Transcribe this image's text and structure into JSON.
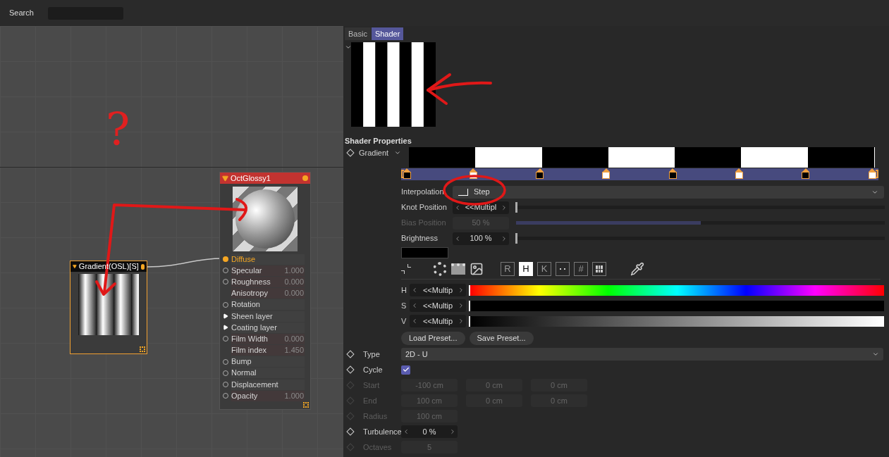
{
  "search": {
    "label": "Search"
  },
  "annotation": {
    "question": "?"
  },
  "nodes": [
    {
      "kind": "material",
      "title": "OctGlossy1",
      "selected": false,
      "ports": [
        {
          "kind": "port",
          "label": "Diffuse",
          "connected": true
        },
        {
          "kind": "port",
          "label": "Specular",
          "value": "1.000",
          "connected": false
        },
        {
          "kind": "port",
          "label": "Roughness",
          "value": "0.000",
          "connected": false
        },
        {
          "kind": "none",
          "label": "Anisotropy",
          "value": "0.000"
        },
        {
          "kind": "port",
          "label": "Rotation",
          "connected": false
        },
        {
          "kind": "group",
          "label": "Sheen layer"
        },
        {
          "kind": "group",
          "label": "Coating layer"
        },
        {
          "kind": "port",
          "label": "Film Width",
          "value": "0.000",
          "connected": false
        },
        {
          "kind": "none",
          "label": "Film index",
          "value": "1.450"
        },
        {
          "kind": "port",
          "label": "Bump",
          "connected": false
        },
        {
          "kind": "port",
          "label": "Normal",
          "connected": false
        },
        {
          "kind": "port",
          "label": "Displacement",
          "connected": false
        },
        {
          "kind": "port",
          "label": "Opacity",
          "value": "1.000",
          "connected": false
        }
      ]
    },
    {
      "kind": "texture",
      "title": "Gradient(OSL)[S]",
      "selected": true
    }
  ],
  "tabs": [
    {
      "label": "Basic",
      "selected": false
    },
    {
      "label": "Shader",
      "selected": true
    }
  ],
  "section_title": "Shader Properties",
  "gradient": {
    "label": "Gradient",
    "knots": [
      {
        "color": "#000000"
      },
      {
        "color": "#ffffff"
      },
      {
        "color": "#000000"
      },
      {
        "color": "#ffffff"
      },
      {
        "color": "#000000"
      },
      {
        "color": "#ffffff"
      },
      {
        "color": "#000000"
      },
      {
        "color": "#ffffff"
      }
    ]
  },
  "knot_settings": [
    {
      "kind": "dropdown",
      "label": "Interpolation",
      "value": "Step",
      "disabled": false
    },
    {
      "kind": "slider",
      "label": "Knot Position",
      "value": "<<Multipl",
      "level": 0,
      "disabled": false
    },
    {
      "kind": "slider",
      "label": "Bias Position",
      "value": "50 %",
      "level": 0.5,
      "disabled": true
    },
    {
      "kind": "slider",
      "label": "Brightness",
      "value": "100 %",
      "level": 0,
      "disabled": false
    }
  ],
  "swatch": {
    "color": "#000000"
  },
  "color_modes": [
    {
      "label": "R",
      "selected": false
    },
    {
      "label": "H",
      "selected": true
    },
    {
      "label": "K",
      "selected": false
    },
    {
      "label": "#",
      "selected": false
    }
  ],
  "channels": [
    {
      "kind": "hue",
      "label": "H",
      "value": "<<Multip"
    },
    {
      "kind": "saturation",
      "label": "S",
      "value": "<<Multip"
    },
    {
      "kind": "value",
      "label": "V",
      "value": "<<Multip"
    }
  ],
  "preset_buttons": [
    "Load Preset...",
    "Save Preset..."
  ],
  "properties": [
    {
      "kind": "dropdown",
      "label": "Type",
      "value": "2D - U",
      "disabled": false
    },
    {
      "kind": "checkbox",
      "label": "Cycle",
      "checked": true,
      "disabled": false
    },
    {
      "kind": "vector",
      "label": "Start",
      "values": [
        "-100 cm",
        "0 cm",
        "0 cm"
      ],
      "disabled": true
    },
    {
      "kind": "vector",
      "label": "End",
      "values": [
        "100 cm",
        "0 cm",
        "0 cm"
      ],
      "disabled": true
    },
    {
      "kind": "vector",
      "label": "Radius",
      "values": [
        "100 cm"
      ],
      "disabled": true
    },
    {
      "kind": "spinner",
      "label": "Turbulence",
      "value": "0 %",
      "disabled": false
    },
    {
      "kind": "vector",
      "label": "Octaves",
      "values": [
        "5"
      ],
      "disabled": true
    }
  ]
}
